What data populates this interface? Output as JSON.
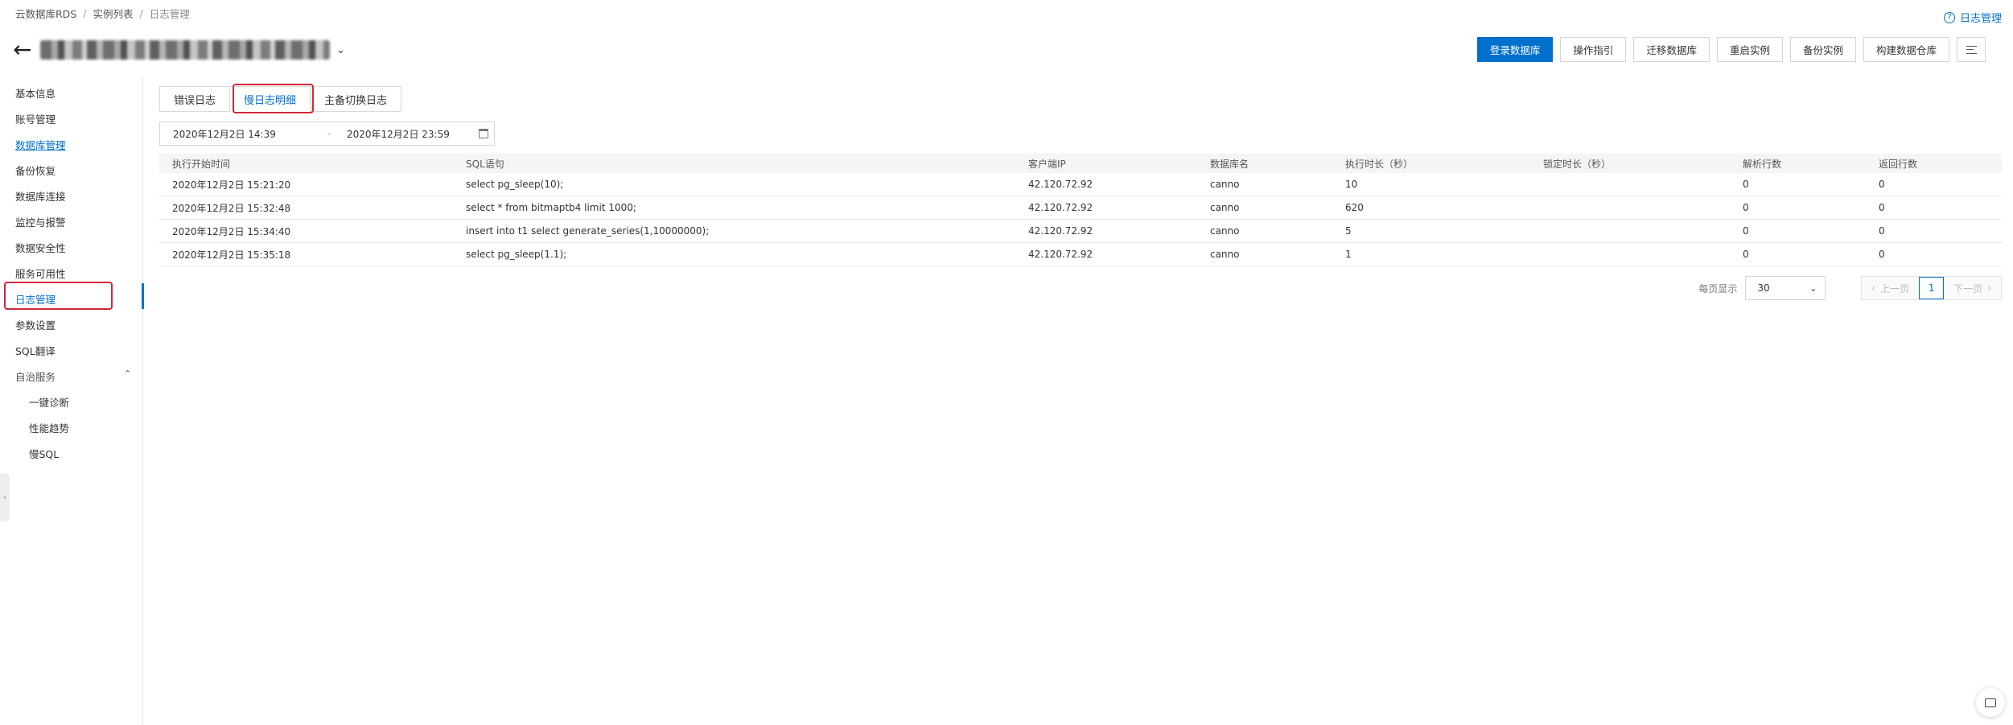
{
  "breadcrumb": {
    "items": [
      "云数据库RDS",
      "实例列表",
      "日志管理"
    ]
  },
  "help_link": {
    "label": "日志管理",
    "icon": "help-circle-icon"
  },
  "header": {
    "instance_name_blurred": "pgm-bp1r5Ot3r5mhlbg3Y5"
  },
  "toolbar": {
    "login_db": "登录数据库",
    "guide": "操作指引",
    "migrate": "迁移数据库",
    "restart": "重启实例",
    "backup": "备份实例",
    "build_warehouse": "构建数据仓库",
    "more_icon": "menu-icon"
  },
  "sidebar": {
    "items": [
      {
        "label": "基本信息"
      },
      {
        "label": "账号管理"
      },
      {
        "label": "数据库管理"
      },
      {
        "label": "备份恢复"
      },
      {
        "label": "数据库连接"
      },
      {
        "label": "监控与报警"
      },
      {
        "label": "数据安全性"
      },
      {
        "label": "服务可用性"
      },
      {
        "label": "日志管理"
      },
      {
        "label": "参数设置"
      },
      {
        "label": "SQL翻译"
      },
      {
        "label": "自治服务"
      },
      {
        "label": "一键诊断"
      },
      {
        "label": "性能趋势"
      },
      {
        "label": "慢SQL"
      }
    ]
  },
  "tabs": [
    "错误日志",
    "慢日志明细",
    "主备切换日志"
  ],
  "date_range": {
    "start": "2020年12月2日 14:39",
    "separator": "-",
    "end": "2020年12月2日 23:59"
  },
  "table": {
    "columns": [
      "执行开始时间",
      "SQL语句",
      "客户端IP",
      "数据库名",
      "执行时长（秒）",
      "锁定时长（秒）",
      "解析行数",
      "返回行数"
    ],
    "rows": [
      [
        "2020年12月2日 15:21:20",
        "select pg_sleep(10);",
        "42.120.72.92",
        "canno",
        "10",
        "",
        "0",
        "0"
      ],
      [
        "2020年12月2日 15:32:48",
        "select * from bitmaptb4 limit 1000;",
        "42.120.72.92",
        "canno",
        "620",
        "",
        "0",
        "0"
      ],
      [
        "2020年12月2日 15:34:40",
        "insert into t1 select generate_series(1,10000000);",
        "42.120.72.92",
        "canno",
        "5",
        "",
        "0",
        "0"
      ],
      [
        "2020年12月2日 15:35:18",
        "select pg_sleep(1.1);",
        "42.120.72.92",
        "canno",
        "1",
        "",
        "0",
        "0"
      ]
    ]
  },
  "pager": {
    "page_size_label": "每页显示",
    "page_size": "30",
    "prev": "上一页",
    "current": "1",
    "next": "下一页"
  },
  "colors": {
    "accent": "#0070cc",
    "highlight": "#d0293b"
  }
}
